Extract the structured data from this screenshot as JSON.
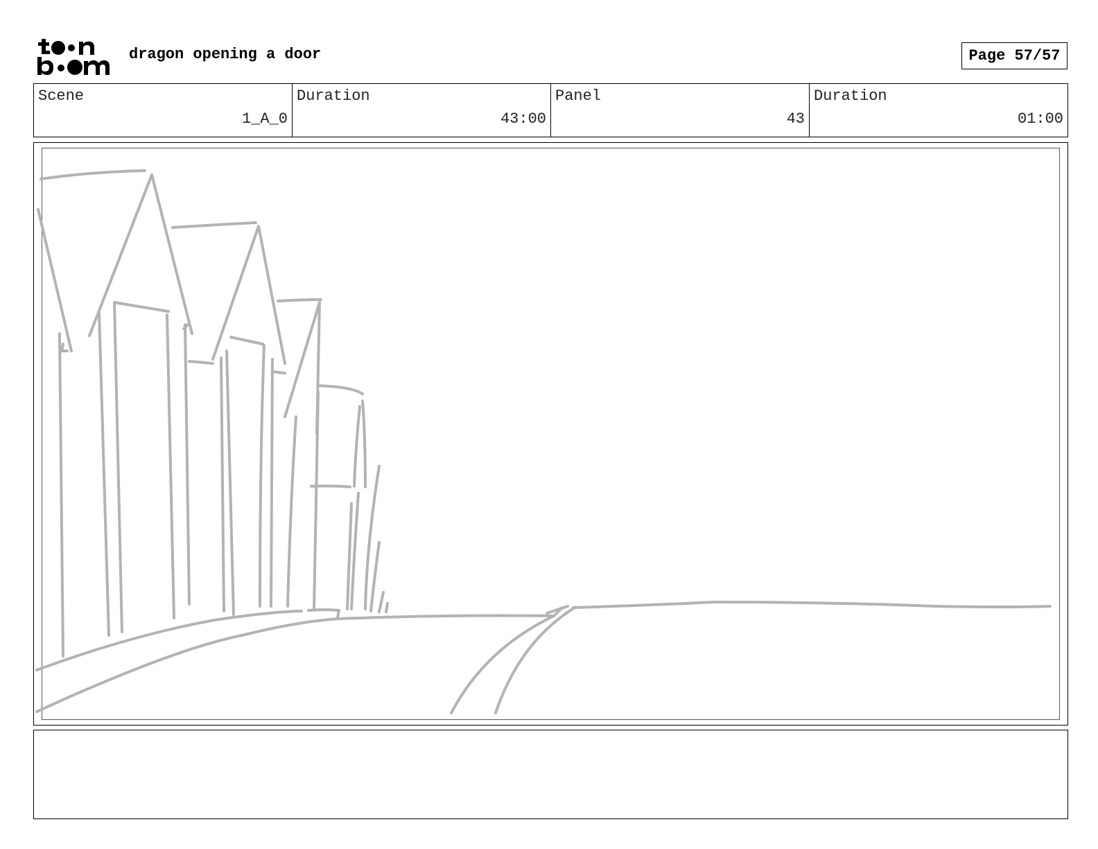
{
  "header": {
    "logo_line1": "t●●n",
    "logo_line2": "b●●m",
    "title": "dragon opening a door",
    "page_label": "Page 57/57"
  },
  "info": {
    "scene_label": "Scene",
    "scene_value": "1_A_0",
    "scene_duration_label": "Duration",
    "scene_duration_value": "43:00",
    "panel_label": "Panel",
    "panel_value": "43",
    "panel_duration_label": "Duration",
    "panel_duration_value": "01:00"
  },
  "sketch": {
    "stroke_color": "#b3b3b3"
  },
  "notes": {
    "text": ""
  }
}
